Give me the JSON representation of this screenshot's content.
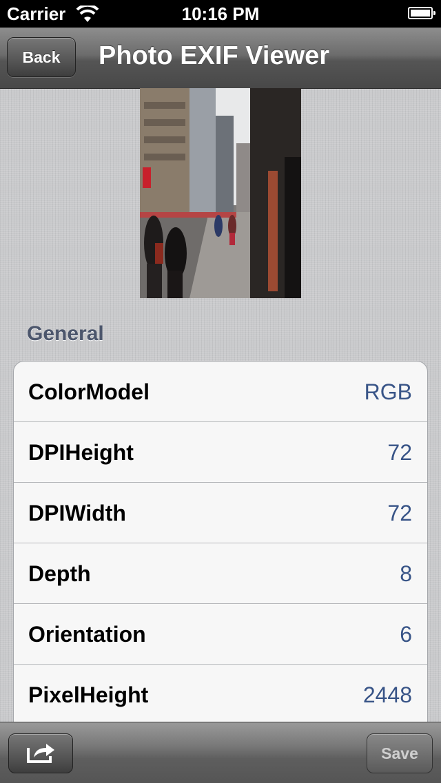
{
  "status_bar": {
    "carrier": "Carrier",
    "time": "10:16 PM",
    "icons": [
      "wifi-icon",
      "battery-icon"
    ]
  },
  "nav_bar": {
    "back_label": "Back",
    "title": "Photo EXIF Viewer"
  },
  "photo": {
    "subject": "street-photo"
  },
  "section": {
    "title": "General"
  },
  "rows": [
    {
      "key": "ColorModel",
      "value": "RGB"
    },
    {
      "key": "DPIHeight",
      "value": "72"
    },
    {
      "key": "DPIWidth",
      "value": "72"
    },
    {
      "key": "Depth",
      "value": "8"
    },
    {
      "key": "Orientation",
      "value": "6"
    },
    {
      "key": "PixelHeight",
      "value": "2448"
    }
  ],
  "toolbar": {
    "share_icon": "share-icon",
    "save_label": "Save"
  },
  "colors": {
    "value_text": "#385487",
    "section_header": "#4c566c",
    "background": "#c9cacc"
  }
}
